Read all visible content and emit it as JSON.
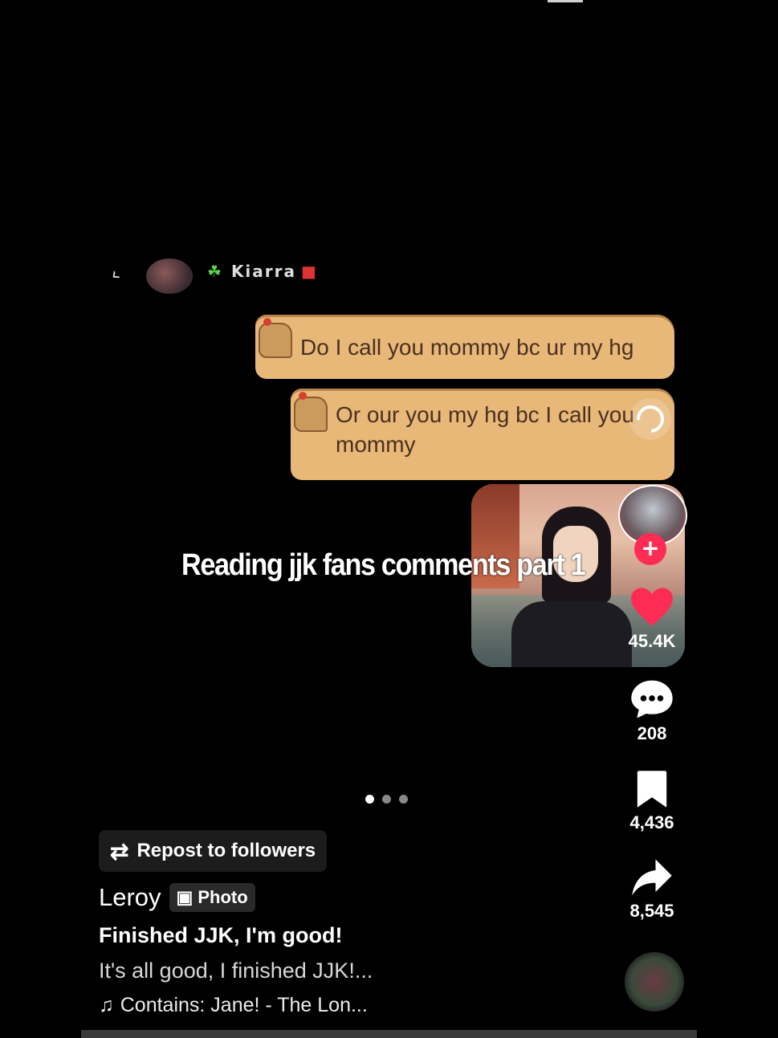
{
  "chat": {
    "contact_name": "Kiarra",
    "messages": [
      "Do I call you mommy bc ur my hg",
      "Or our you my hg bc I call you mommy"
    ]
  },
  "video": {
    "overlay_title": "Reading jjk fans comments part 1"
  },
  "actions": {
    "likes": "45.4K",
    "comments": "208",
    "saves": "4,436",
    "shares": "8,545",
    "follow_symbol": "+"
  },
  "repost": {
    "label": "Repost to followers"
  },
  "post": {
    "author": "Leroy",
    "type_badge": "Photo",
    "title": "Finished JJK, I'm good!",
    "description": "It's all good, I finished JJK!...",
    "music": "Contains: Jane! - The Lon..."
  },
  "carousel": {
    "count": 3,
    "active": 1
  },
  "colors": {
    "like": "#fe2c55",
    "bubble": "#e8b878"
  },
  "icons": [
    "back-arrow-icon",
    "reply-icon",
    "heart-icon",
    "comment-icon",
    "bookmark-icon",
    "share-icon",
    "repost-icon",
    "photo-icon",
    "music-note-icon"
  ]
}
